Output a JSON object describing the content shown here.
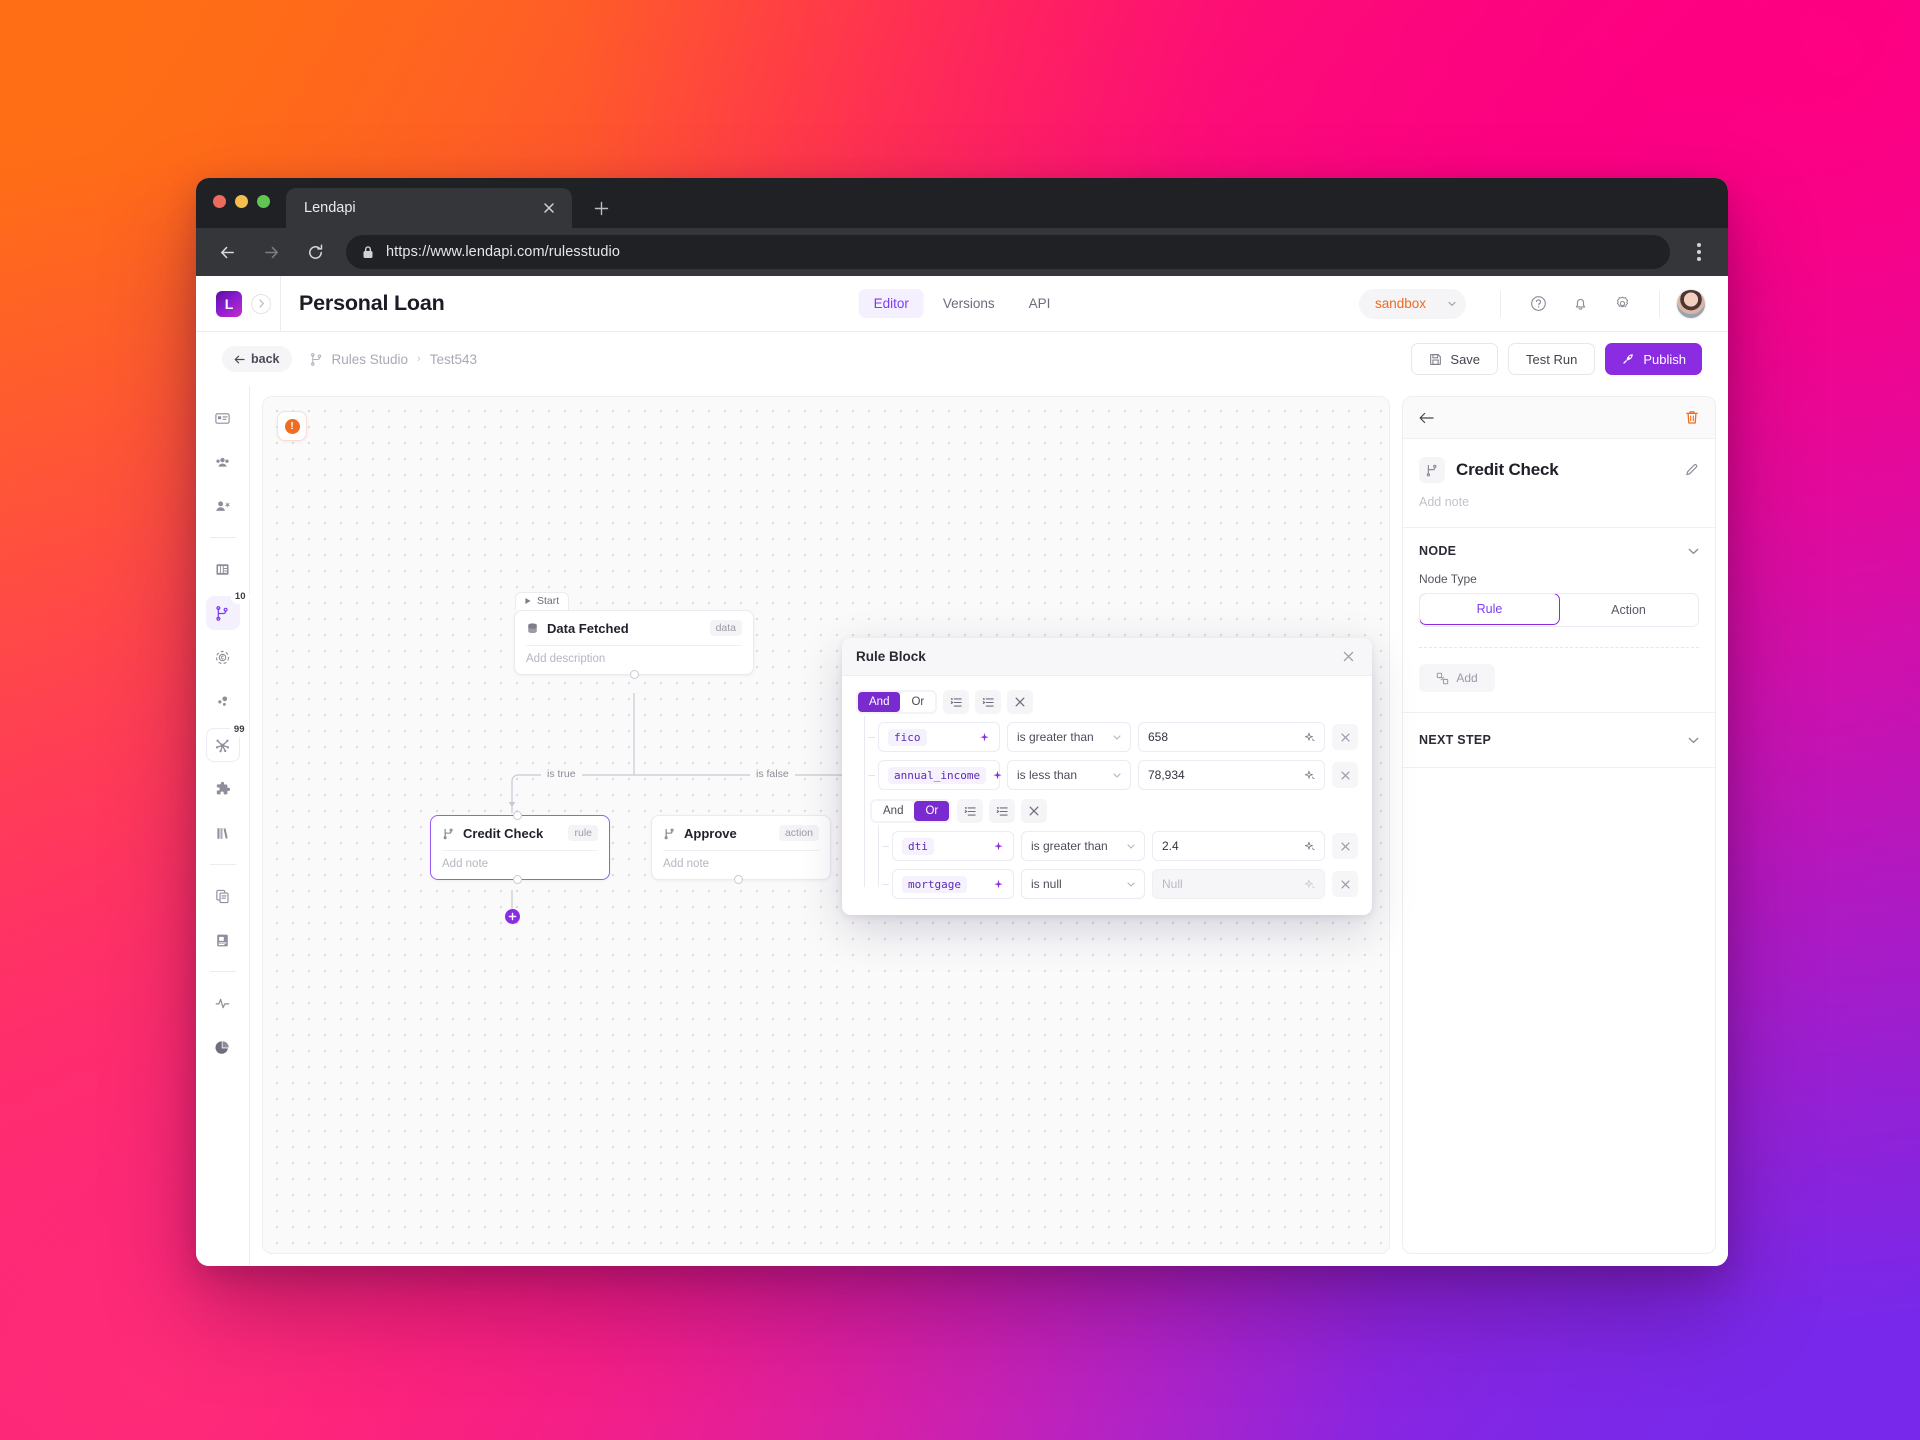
{
  "browser": {
    "tab_title": "Lendapi",
    "close_icon": "close-icon",
    "new_tab_icon": "plus-icon",
    "back_icon": "arrow-left-icon",
    "forward_icon": "arrow-right-icon",
    "reload_icon": "reload-icon",
    "lock_icon": "lock-icon",
    "url": "https://www.lendapi.com/rulesstudio",
    "menu_icon": "kebab-menu-icon"
  },
  "header": {
    "logo_letter": "L",
    "collapse_icon": "chevron-right-icon",
    "page_title": "Personal Loan",
    "tabs": [
      {
        "label": "Editor",
        "active": true
      },
      {
        "label": "Versions",
        "active": false
      },
      {
        "label": "API",
        "active": false
      }
    ],
    "env": {
      "label": "sandbox",
      "caret_icon": "chevron-down-icon"
    },
    "icons": [
      {
        "name": "help-icon"
      },
      {
        "name": "bell-icon"
      },
      {
        "name": "gear-icon"
      }
    ],
    "avatar": "user-avatar"
  },
  "subbar": {
    "back_label": "back",
    "back_icon": "arrow-left-icon",
    "breadcrumb": {
      "icon": "flow-icon",
      "root": "Rules Studio",
      "separator": "›",
      "current": "Test543"
    },
    "save_label": "Save",
    "save_icon": "save-icon",
    "test_run_label": "Test Run",
    "publish_label": "Publish",
    "publish_icon": "rocket-icon"
  },
  "rail": {
    "items": [
      {
        "name": "sidebar-item-applications",
        "icon": "id-card-icon",
        "badge": null,
        "active": false,
        "boxed": false
      },
      {
        "name": "sidebar-item-customers",
        "icon": "people-icon",
        "badge": null,
        "active": false,
        "boxed": false
      },
      {
        "name": "sidebar-item-add-user",
        "icon": "user-plus-icon",
        "badge": null,
        "active": false,
        "boxed": false
      },
      {
        "divider": true
      },
      {
        "name": "sidebar-item-tables",
        "icon": "table-icon",
        "badge": null,
        "active": false,
        "boxed": false
      },
      {
        "name": "sidebar-item-rules-studio",
        "icon": "flow-icon",
        "badge": "10",
        "active": true,
        "boxed": false
      },
      {
        "name": "sidebar-item-decisions",
        "icon": "coin-refresh-icon",
        "badge": null,
        "active": false,
        "boxed": false
      },
      {
        "name": "sidebar-item-data-points",
        "icon": "dots-icon",
        "badge": null,
        "active": false,
        "boxed": false
      },
      {
        "name": "sidebar-item-integrations",
        "icon": "hub-icon",
        "badge": "99",
        "active": false,
        "boxed": true
      },
      {
        "name": "sidebar-item-plugins",
        "icon": "puzzle-icon",
        "badge": null,
        "active": false,
        "boxed": false
      },
      {
        "name": "sidebar-item-library",
        "icon": "books-icon",
        "badge": null,
        "active": false,
        "boxed": false
      },
      {
        "divider": true
      },
      {
        "name": "sidebar-item-copies",
        "icon": "copy-icon",
        "badge": null,
        "active": false,
        "boxed": false
      },
      {
        "name": "sidebar-item-documents",
        "icon": "document-icon",
        "badge": null,
        "active": false,
        "boxed": false
      },
      {
        "divider": true
      },
      {
        "name": "sidebar-item-monitoring",
        "icon": "pulse-icon",
        "badge": null,
        "active": false,
        "boxed": false
      },
      {
        "name": "sidebar-item-reports",
        "icon": "pie-chart-icon",
        "badge": null,
        "active": false,
        "boxed": false
      }
    ]
  },
  "canvas": {
    "warning_icon": "warning-icon",
    "warning_mark": "!",
    "nodes": [
      {
        "key": "data_fetched",
        "flag": "Start",
        "flag_icon": "play-icon",
        "icon": "database-icon",
        "title": "Data Fetched",
        "tag": "data",
        "note": "Add description",
        "selected": false
      },
      {
        "key": "credit_check",
        "icon": "rule-icon",
        "title": "Credit Check",
        "tag": "rule",
        "note": "Add note",
        "selected": true
      },
      {
        "key": "approve",
        "icon": "rule-icon",
        "title": "Approve",
        "tag": "action",
        "note": "Add note",
        "selected": false
      }
    ],
    "edges": [
      {
        "label": "is true"
      },
      {
        "label": "is false"
      }
    ],
    "add_node_icon": "plus-icon"
  },
  "dialog": {
    "title": "Rule Block",
    "close_icon": "close-icon",
    "groups": [
      {
        "operators": [
          {
            "label": "And",
            "selected": true
          },
          {
            "label": "Or",
            "selected": false
          }
        ],
        "tool_icons": [
          "indent-add-icon",
          "indent-group-icon",
          "remove-icon"
        ],
        "conditions": [
          {
            "field": "fico",
            "field_sparkle": "sparkle-icon",
            "operator": "is greater than",
            "operator_caret": "chevron-down-icon",
            "value": "658",
            "value_placeholder": "",
            "value_sparkle": "sparkle-icon",
            "remove_icon": "close-icon",
            "disabled": false
          },
          {
            "field": "annual_income",
            "field_sparkle": "sparkle-icon",
            "operator": "is less than",
            "operator_caret": "chevron-down-icon",
            "value": "78,934",
            "value_placeholder": "",
            "value_sparkle": "sparkle-icon",
            "remove_icon": "close-icon",
            "disabled": false
          }
        ],
        "nested": {
          "operators": [
            {
              "label": "And",
              "selected": false
            },
            {
              "label": "Or",
              "selected": true
            }
          ],
          "tool_icons": [
            "indent-add-icon",
            "indent-group-icon",
            "remove-icon"
          ],
          "conditions": [
            {
              "field": "dti",
              "field_sparkle": "sparkle-icon",
              "operator": "is greater than",
              "operator_caret": "chevron-down-icon",
              "value": "2.4",
              "value_placeholder": "",
              "value_sparkle": "sparkle-icon",
              "remove_icon": "close-icon",
              "disabled": false
            },
            {
              "field": "mortgage",
              "field_sparkle": "sparkle-icon",
              "operator": "is null",
              "operator_caret": "chevron-down-icon",
              "value": "",
              "value_placeholder": "Null",
              "value_sparkle": "sparkle-icon",
              "remove_icon": "close-icon",
              "disabled": true
            }
          ]
        }
      }
    ]
  },
  "panel": {
    "back_icon": "arrow-left-icon",
    "delete_icon": "trash-icon",
    "node_icon": "rule-icon",
    "node_title": "Credit Check",
    "edit_icon": "pencil-icon",
    "note_placeholder": "Add note",
    "node_section": {
      "title": "NODE",
      "chevron_icon": "chevron-down-icon"
    },
    "node_type_label": "Node Type",
    "node_types": [
      {
        "label": "Rule",
        "selected": true
      },
      {
        "label": "Action",
        "selected": false
      }
    ],
    "add_label": "Add",
    "add_icon": "blocks-icon",
    "next_step_section": {
      "title": "NEXT STEP",
      "chevron_icon": "chevron-down-icon"
    }
  },
  "colors": {
    "accent_purple": "#8b2be2",
    "accent_purple_soft": "#7a3df0",
    "env_orange": "#f06a1e",
    "warning_orange": "#ef6c23",
    "danger_orange": "#ef6c23"
  }
}
